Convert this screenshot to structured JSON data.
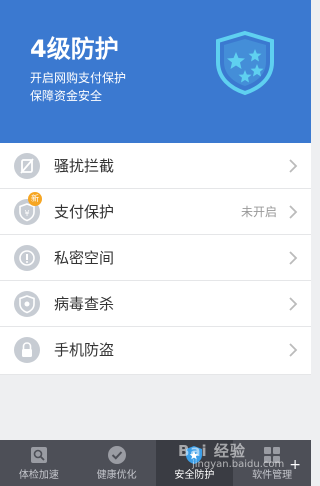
{
  "header": {
    "level": "4级防护",
    "line1": "开启网购支付保护",
    "line2": "保障资金安全"
  },
  "colors": {
    "accent": "#3b79d0",
    "tabbar": "#4d4f57",
    "badge": "#f6a623"
  },
  "list": [
    {
      "label": "骚扰拦截",
      "icon": "block-icon",
      "status": ""
    },
    {
      "label": "支付保护",
      "icon": "yen-shield-icon",
      "status": "未开启",
      "badge": "新"
    },
    {
      "label": "私密空间",
      "icon": "privacy-icon",
      "status": ""
    },
    {
      "label": "病毒查杀",
      "icon": "virus-shield-icon",
      "status": ""
    },
    {
      "label": "手机防盗",
      "icon": "lock-icon",
      "status": ""
    }
  ],
  "tabs": [
    {
      "label": "体检加速",
      "icon": "search-icon"
    },
    {
      "label": "健康优化",
      "icon": "check-icon"
    },
    {
      "label": "安全防护",
      "icon": "shield-icon",
      "active": true
    },
    {
      "label": "软件管理",
      "icon": "apps-icon"
    }
  ],
  "watermark": {
    "main": "Bai 经验",
    "sub": "jingyan.baidu.com"
  }
}
